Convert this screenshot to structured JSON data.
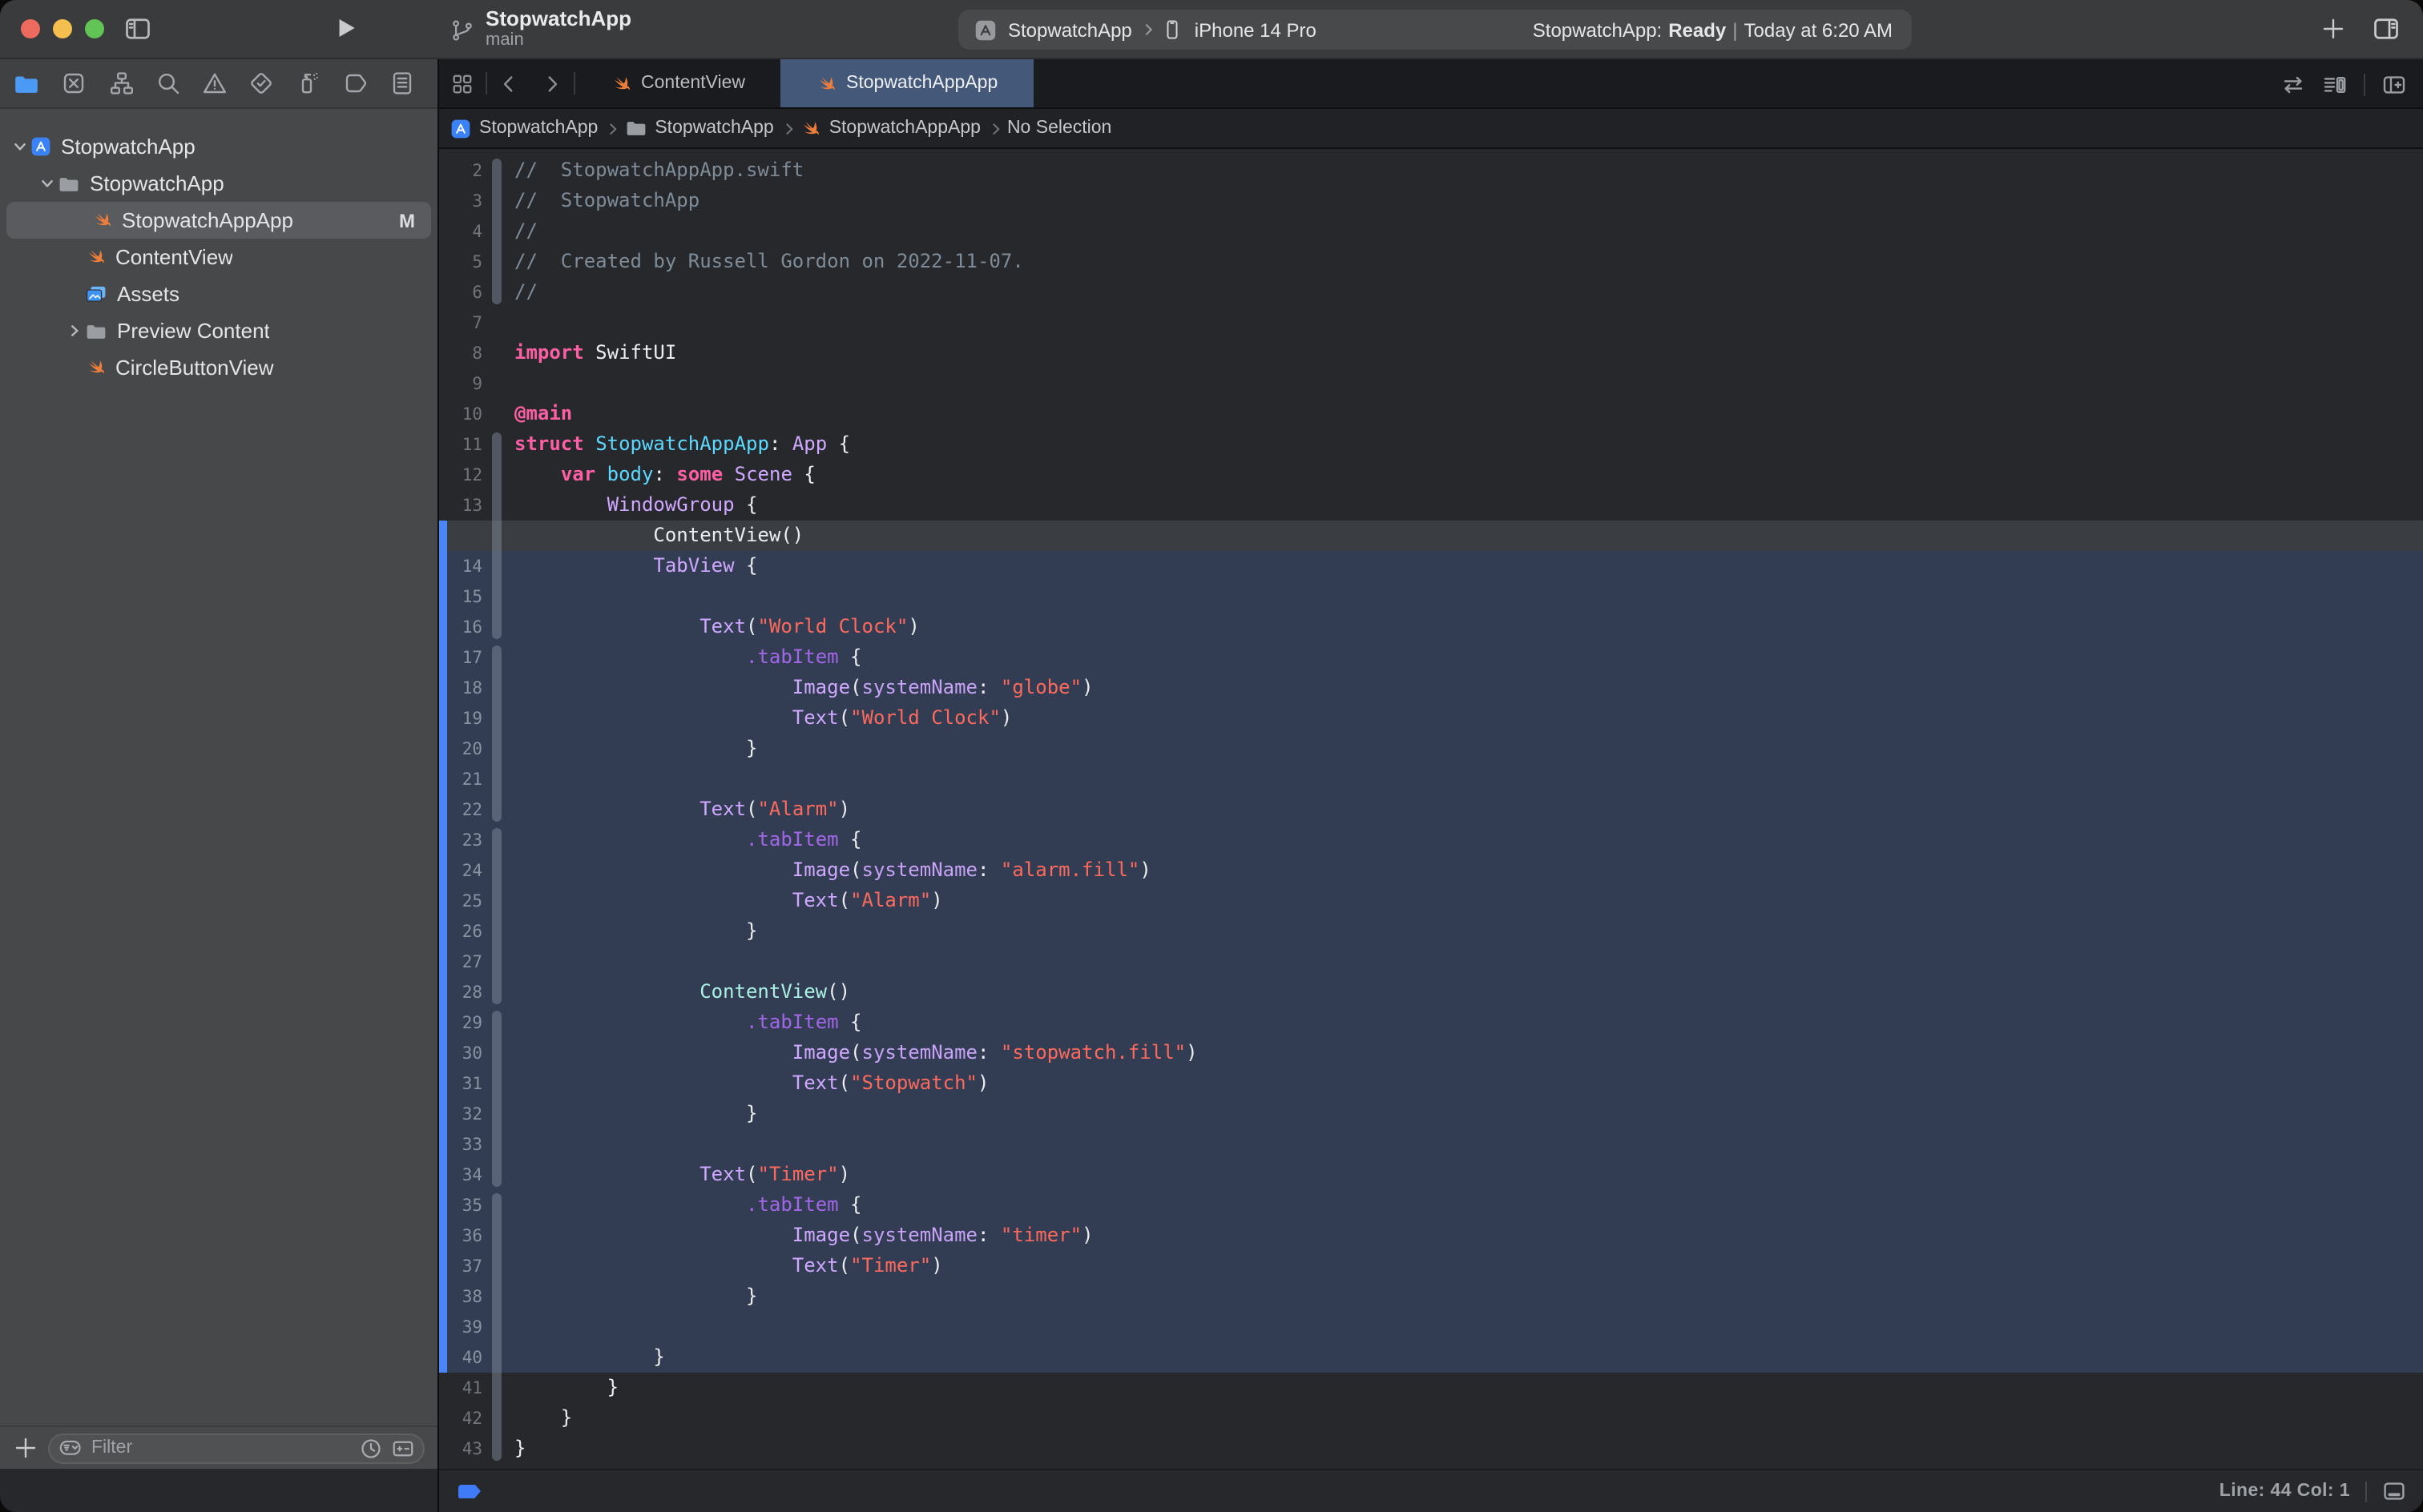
{
  "titlebar": {
    "project_title": "StopwatchApp",
    "branch": "main",
    "scheme": {
      "target": "StopwatchApp",
      "destination": "iPhone 14 Pro"
    },
    "status": {
      "app": "StopwatchApp:",
      "state": "Ready",
      "separator": "|",
      "time": "Today at 6:20 AM"
    }
  },
  "navigator": {
    "rail": [
      {
        "name": "project-navigator",
        "icon": "folderFill",
        "selected": true
      },
      {
        "name": "source-control-navigator",
        "icon": "changes",
        "selected": false
      },
      {
        "name": "symbol-navigator",
        "icon": "symbols",
        "selected": false
      },
      {
        "name": "find-navigator",
        "icon": "find",
        "selected": false
      },
      {
        "name": "issue-navigator",
        "icon": "issues",
        "selected": false
      },
      {
        "name": "test-navigator",
        "icon": "tests",
        "selected": false
      },
      {
        "name": "debug-navigator",
        "icon": "debug",
        "selected": false
      },
      {
        "name": "breakpoint-navigator",
        "icon": "breakpoints",
        "selected": false
      },
      {
        "name": "report-navigator",
        "icon": "reports",
        "selected": false
      }
    ],
    "tree": [
      {
        "label": "StopwatchApp",
        "icon": "appicon",
        "level": 0,
        "disclosure": "open",
        "selected": false,
        "badge": ""
      },
      {
        "label": "StopwatchApp",
        "icon": "folderGrey",
        "level": 1,
        "disclosure": "open",
        "selected": false,
        "badge": ""
      },
      {
        "label": "StopwatchAppApp",
        "icon": "swift",
        "level": 2,
        "disclosure": "",
        "selected": true,
        "badge": "M"
      },
      {
        "label": "ContentView",
        "icon": "swift",
        "level": 2,
        "disclosure": "",
        "selected": false,
        "badge": ""
      },
      {
        "label": "Assets",
        "icon": "assets",
        "level": 2,
        "disclosure": "",
        "selected": false,
        "badge": ""
      },
      {
        "label": "Preview Content",
        "icon": "folderGrey",
        "level": 2,
        "disclosure": "closed",
        "selected": false,
        "badge": ""
      },
      {
        "label": "CircleButtonView",
        "icon": "swift",
        "level": 2,
        "disclosure": "",
        "selected": false,
        "badge": ""
      }
    ],
    "filter_placeholder": "Filter"
  },
  "editor": {
    "tabs": [
      {
        "label": "ContentView",
        "icon": "swift",
        "active": false
      },
      {
        "label": "StopwatchAppApp",
        "icon": "swift",
        "active": true
      }
    ],
    "breadcrumbs": [
      {
        "label": "StopwatchApp",
        "icon": "appicon"
      },
      {
        "label": "StopwatchApp",
        "icon": "folderGrey"
      },
      {
        "label": "StopwatchAppApp",
        "icon": "swift"
      },
      {
        "label": "No Selection",
        "icon": ""
      }
    ],
    "footer": {
      "line_col": "Line: 44  Col: 1"
    },
    "code": {
      "lines": [
        {
          "n": "2",
          "r": "",
          "g": "start",
          "t": [
            [
              "c",
              "//  StopwatchAppApp.swift"
            ]
          ]
        },
        {
          "n": "3",
          "r": "",
          "g": "mid",
          "t": [
            [
              "c",
              "//  StopwatchApp"
            ]
          ]
        },
        {
          "n": "4",
          "r": "",
          "g": "mid",
          "t": [
            [
              "c",
              "//"
            ]
          ]
        },
        {
          "n": "5",
          "r": "",
          "g": "mid",
          "t": [
            [
              "c",
              "//  Created by Russell Gordon on 2022-11-07."
            ]
          ]
        },
        {
          "n": "6",
          "r": "",
          "g": "end",
          "t": [
            [
              "c",
              "//"
            ]
          ]
        },
        {
          "n": "7",
          "r": "",
          "g": "",
          "t": []
        },
        {
          "n": "8",
          "r": "",
          "g": "",
          "t": [
            [
              "k",
              "import"
            ],
            [
              "p",
              " SwiftUI"
            ]
          ]
        },
        {
          "n": "9",
          "r": "",
          "g": "",
          "t": []
        },
        {
          "n": "10",
          "r": "",
          "g": "",
          "t": [
            [
              "k",
              "@main"
            ]
          ]
        },
        {
          "n": "11",
          "r": "",
          "g": "start",
          "t": [
            [
              "k",
              "struct"
            ],
            [
              "p",
              " "
            ],
            [
              "td",
              "StopwatchAppApp"
            ],
            [
              "p",
              ": "
            ],
            [
              "st",
              "App"
            ],
            [
              "p",
              " {"
            ]
          ]
        },
        {
          "n": "12",
          "r": "",
          "g": "mid",
          "t": [
            [
              "p",
              "    "
            ],
            [
              "k",
              "var"
            ],
            [
              "p",
              " "
            ],
            [
              "td",
              "body"
            ],
            [
              "p",
              ": "
            ],
            [
              "k",
              "some"
            ],
            [
              "p",
              " "
            ],
            [
              "st",
              "Scene"
            ],
            [
              "p",
              " {"
            ]
          ]
        },
        {
          "n": "13",
          "r": "",
          "g": "mid",
          "t": [
            [
              "p",
              "        "
            ],
            [
              "st",
              "WindowGroup"
            ],
            [
              "p",
              " {"
            ]
          ]
        },
        {
          "n": "",
          "r": "cur",
          "g": "mid",
          "t": [
            [
              "p",
              "            ContentView()"
            ]
          ]
        },
        {
          "n": "14",
          "r": "sel",
          "g": "mid",
          "t": [
            [
              "p",
              "            "
            ],
            [
              "st",
              "TabView"
            ],
            [
              "p",
              " {"
            ]
          ]
        },
        {
          "n": "15",
          "r": "sel",
          "g": "mid",
          "t": []
        },
        {
          "n": "16",
          "r": "sel",
          "g": "end",
          "t": [
            [
              "p",
              "                "
            ],
            [
              "st",
              "Text"
            ],
            [
              "p",
              "("
            ],
            [
              "s",
              "\"World Clock\""
            ],
            [
              "p",
              ")"
            ]
          ]
        },
        {
          "n": "17",
          "r": "sel",
          "g": "start",
          "t": [
            [
              "p",
              "                    "
            ],
            [
              "fn",
              ".tabItem"
            ],
            [
              "p",
              " {"
            ]
          ]
        },
        {
          "n": "18",
          "r": "sel",
          "g": "mid",
          "t": [
            [
              "p",
              "                        "
            ],
            [
              "st",
              "Image"
            ],
            [
              "p",
              "("
            ],
            [
              "pr",
              "systemName"
            ],
            [
              "p",
              ": "
            ],
            [
              "s",
              "\"globe\""
            ],
            [
              "p",
              ")"
            ]
          ]
        },
        {
          "n": "19",
          "r": "sel",
          "g": "mid",
          "t": [
            [
              "p",
              "                        "
            ],
            [
              "st",
              "Text"
            ],
            [
              "p",
              "("
            ],
            [
              "s",
              "\"World Clock\""
            ],
            [
              "p",
              ")"
            ]
          ]
        },
        {
          "n": "20",
          "r": "sel",
          "g": "mid",
          "t": [
            [
              "p",
              "                    }"
            ]
          ]
        },
        {
          "n": "21",
          "r": "sel",
          "g": "mid",
          "t": []
        },
        {
          "n": "22",
          "r": "sel",
          "g": "end",
          "t": [
            [
              "p",
              "                "
            ],
            [
              "st",
              "Text"
            ],
            [
              "p",
              "("
            ],
            [
              "s",
              "\"Alarm\""
            ],
            [
              "p",
              ")"
            ]
          ]
        },
        {
          "n": "23",
          "r": "sel",
          "g": "start",
          "t": [
            [
              "p",
              "                    "
            ],
            [
              "fn",
              ".tabItem"
            ],
            [
              "p",
              " {"
            ]
          ]
        },
        {
          "n": "24",
          "r": "sel",
          "g": "mid",
          "t": [
            [
              "p",
              "                        "
            ],
            [
              "st",
              "Image"
            ],
            [
              "p",
              "("
            ],
            [
              "pr",
              "systemName"
            ],
            [
              "p",
              ": "
            ],
            [
              "s",
              "\"alarm.fill\""
            ],
            [
              "p",
              ")"
            ]
          ]
        },
        {
          "n": "25",
          "r": "sel",
          "g": "mid",
          "t": [
            [
              "p",
              "                        "
            ],
            [
              "st",
              "Text"
            ],
            [
              "p",
              "("
            ],
            [
              "s",
              "\"Alarm\""
            ],
            [
              "p",
              ")"
            ]
          ]
        },
        {
          "n": "26",
          "r": "sel",
          "g": "mid",
          "t": [
            [
              "p",
              "                    }"
            ]
          ]
        },
        {
          "n": "27",
          "r": "sel",
          "g": "mid",
          "t": []
        },
        {
          "n": "28",
          "r": "sel",
          "g": "end",
          "t": [
            [
              "p",
              "                "
            ],
            [
              "mint",
              "ContentView"
            ],
            [
              "p",
              "()"
            ]
          ]
        },
        {
          "n": "29",
          "r": "sel",
          "g": "start",
          "t": [
            [
              "p",
              "                    "
            ],
            [
              "fn",
              ".tabItem"
            ],
            [
              "p",
              " {"
            ]
          ]
        },
        {
          "n": "30",
          "r": "sel",
          "g": "mid",
          "t": [
            [
              "p",
              "                        "
            ],
            [
              "st",
              "Image"
            ],
            [
              "p",
              "("
            ],
            [
              "pr",
              "systemName"
            ],
            [
              "p",
              ": "
            ],
            [
              "s",
              "\"stopwatch.fill\""
            ],
            [
              "p",
              ")"
            ]
          ]
        },
        {
          "n": "31",
          "r": "sel",
          "g": "mid",
          "t": [
            [
              "p",
              "                        "
            ],
            [
              "st",
              "Text"
            ],
            [
              "p",
              "("
            ],
            [
              "s",
              "\"Stopwatch\""
            ],
            [
              "p",
              ")"
            ]
          ]
        },
        {
          "n": "32",
          "r": "sel",
          "g": "mid",
          "t": [
            [
              "p",
              "                    }"
            ]
          ]
        },
        {
          "n": "33",
          "r": "sel",
          "g": "mid",
          "t": []
        },
        {
          "n": "34",
          "r": "sel",
          "g": "end",
          "t": [
            [
              "p",
              "                "
            ],
            [
              "st",
              "Text"
            ],
            [
              "p",
              "("
            ],
            [
              "s",
              "\"Timer\""
            ],
            [
              "p",
              ")"
            ]
          ]
        },
        {
          "n": "35",
          "r": "sel",
          "g": "start",
          "t": [
            [
              "p",
              "                    "
            ],
            [
              "fn",
              ".tabItem"
            ],
            [
              "p",
              " {"
            ]
          ]
        },
        {
          "n": "36",
          "r": "sel",
          "g": "mid",
          "t": [
            [
              "p",
              "                        "
            ],
            [
              "st",
              "Image"
            ],
            [
              "p",
              "("
            ],
            [
              "pr",
              "systemName"
            ],
            [
              "p",
              ": "
            ],
            [
              "s",
              "\"timer\""
            ],
            [
              "p",
              ")"
            ]
          ]
        },
        {
          "n": "37",
          "r": "sel",
          "g": "mid",
          "t": [
            [
              "p",
              "                        "
            ],
            [
              "st",
              "Text"
            ],
            [
              "p",
              "("
            ],
            [
              "s",
              "\"Timer\""
            ],
            [
              "p",
              ")"
            ]
          ]
        },
        {
          "n": "38",
          "r": "sel",
          "g": "mid",
          "t": [
            [
              "p",
              "                    }"
            ]
          ]
        },
        {
          "n": "39",
          "r": "sel",
          "g": "mid",
          "t": []
        },
        {
          "n": "40",
          "r": "sel",
          "g": "mid",
          "t": [
            [
              "p",
              "            }"
            ]
          ]
        },
        {
          "n": "41",
          "r": "",
          "g": "mid",
          "t": [
            [
              "p",
              "        }"
            ]
          ]
        },
        {
          "n": "42",
          "r": "",
          "g": "mid",
          "t": [
            [
              "p",
              "    }"
            ]
          ]
        },
        {
          "n": "43",
          "r": "",
          "g": "end",
          "t": [
            [
              "p",
              "}"
            ]
          ]
        }
      ]
    }
  },
  "colors": {
    "accent_blue": "#4a86f7",
    "active_tab": "#44587a",
    "selection": "#323d54",
    "keyword": "#fc5fa3",
    "string": "#fc6a5d",
    "sdk_type": "#d0a8ff",
    "type_decl": "#5dd8ff",
    "project_class": "#acf2e4",
    "comment": "#7f8c98"
  }
}
